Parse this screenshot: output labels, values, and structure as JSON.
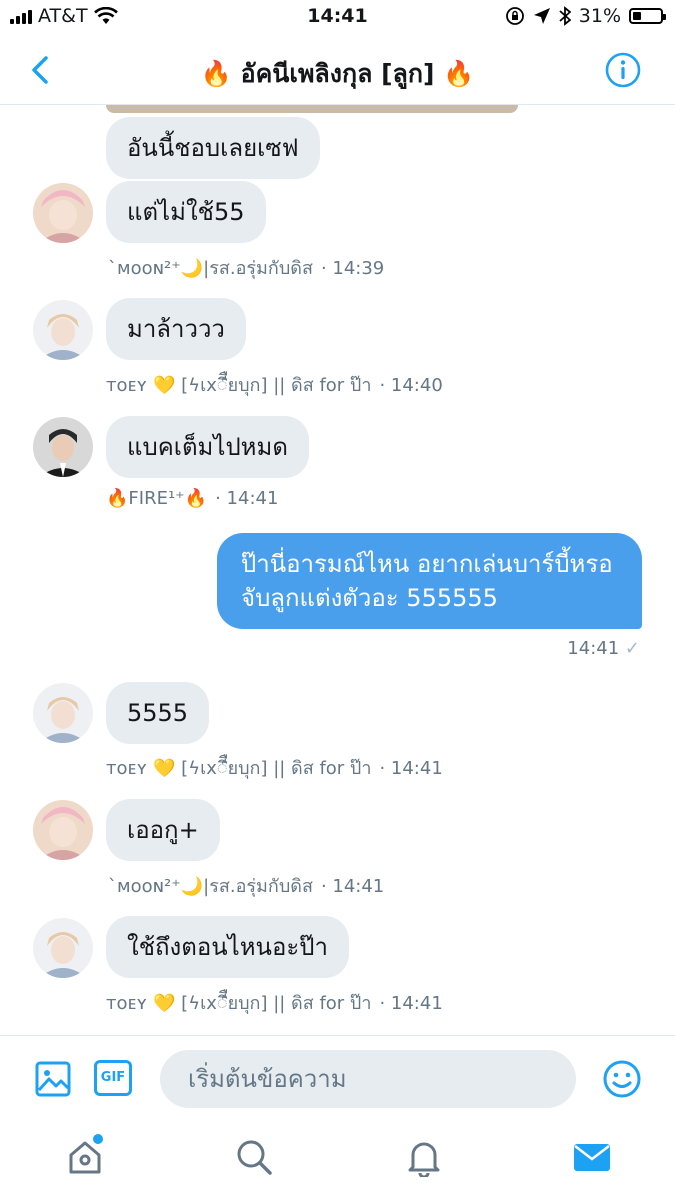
{
  "status_bar": {
    "carrier": "AT&T",
    "time": "14:41",
    "battery_percent": 31,
    "battery_text": "31%"
  },
  "header": {
    "title": "🔥 อัคนีเพลิงกุล [ลูก] 🔥"
  },
  "messages": [
    {
      "text": "อันนี้ชอบเลยเซฟ"
    },
    {
      "text": "แต่ไม่ใช้55",
      "sender": "`ᴍᴏᴏɴ²⁺🌙|รส.อรุ่มกับดิส",
      "time": "· 14:39"
    },
    {
      "text": "มาล้าววว",
      "sender": "ᴛᴏᴇʏ 💛 [ϟเxꢶีืยบุก] || ดิส for ป๊า",
      "time": "· 14:40"
    },
    {
      "text": "แบคเต็มไปหมด",
      "sender": "🔥FIRE¹⁺🔥",
      "time": "· 14:41"
    },
    {
      "text": "ป๊านี่อารมณ์ไหน อยากเล่นบาร์บี้หรอ จับลูกแต่งตัวอะ 555555",
      "time": "14:41",
      "read": "✓"
    },
    {
      "text": "5555",
      "sender": "ᴛᴏᴇʏ 💛 [ϟเxꢶีืยบุก] || ดิส for ป๊า",
      "time": "· 14:41"
    },
    {
      "text": "เออกู+",
      "sender": "`ᴍᴏᴏɴ²⁺🌙|รส.อรุ่มกับดิส",
      "time": "· 14:41"
    },
    {
      "text": "ใช้ถึงตอนไหนอะป๊า",
      "sender": "ᴛᴏᴇʏ 💛 [ϟเxꢶีืยบุก] || ดิส for ป๊า",
      "time": "· 14:41"
    }
  ],
  "composer": {
    "gif_label": "GIF",
    "placeholder": "เริ่มต้นข้อความ"
  },
  "colors": {
    "accent": "#1da1f2",
    "outgoing_bubble": "#4a9fec",
    "incoming_bubble": "#e6ecf0",
    "meta_text": "#657786"
  },
  "icons": [
    "back-chevron-icon",
    "info-icon",
    "image-icon",
    "gif-icon",
    "emoji-icon",
    "home-icon",
    "search-icon",
    "bell-icon",
    "mail-icon"
  ]
}
